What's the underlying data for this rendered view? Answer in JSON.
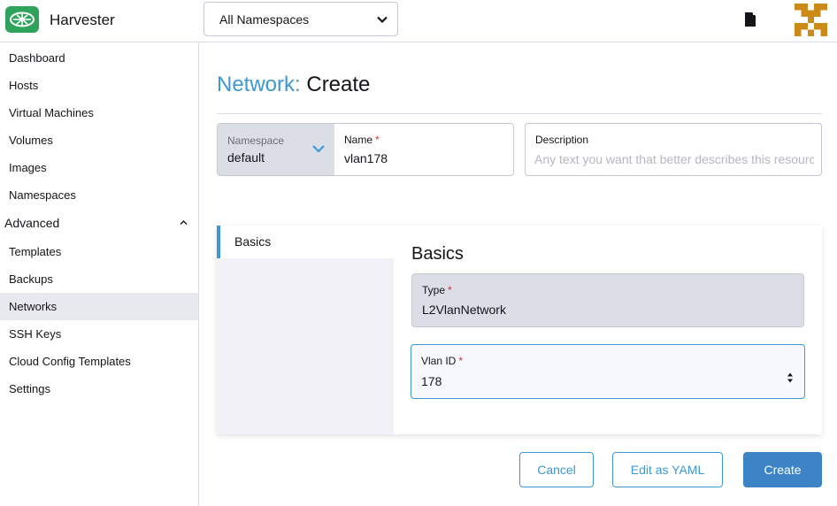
{
  "header": {
    "app_name": "Harvester",
    "namespace_selected": "All Namespaces"
  },
  "sidebar": {
    "items": [
      {
        "label": "Dashboard"
      },
      {
        "label": "Hosts"
      },
      {
        "label": "Virtual Machines"
      },
      {
        "label": "Volumes"
      },
      {
        "label": "Images"
      },
      {
        "label": "Namespaces"
      }
    ],
    "group_label": "Advanced",
    "group_items": [
      {
        "label": "Templates"
      },
      {
        "label": "Backups"
      },
      {
        "label": "Networks",
        "active": true
      },
      {
        "label": "SSH Keys"
      },
      {
        "label": "Cloud Config Templates"
      },
      {
        "label": "Settings"
      }
    ]
  },
  "page": {
    "resource": "Network:",
    "action": "Create"
  },
  "form": {
    "namespace_label": "Namespace",
    "namespace_value": "default",
    "name_label": "Name",
    "name_value": "vlan178",
    "required_marker": "*",
    "description_label": "Description",
    "description_placeholder": "Any text you want that better describes this resource"
  },
  "tabs": [
    {
      "label": "Basics",
      "active": true
    }
  ],
  "basics": {
    "title": "Basics",
    "type_label": "Type",
    "type_value": "L2VlanNetwork",
    "vlan_label": "Vlan ID",
    "vlan_value": "178"
  },
  "footer": {
    "cancel_label": "Cancel",
    "yaml_label": "Edit as YAML",
    "create_label": "Create"
  },
  "colors": {
    "accent": "#3d98d3",
    "brand": "#2fa35c",
    "primary_button": "#3d84c6",
    "required": "#d0312d"
  }
}
